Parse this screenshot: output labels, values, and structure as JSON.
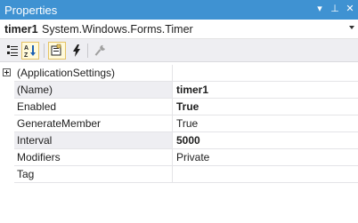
{
  "window": {
    "title": "Properties",
    "buttons": {
      "dropdown": "▾",
      "pin": "⊥",
      "close": "✕"
    }
  },
  "object_selector": {
    "name": "timer1",
    "type": "System.Windows.Forms.Timer"
  },
  "toolbar": {
    "buttons": [
      {
        "icon": "categorized-icon",
        "pressed": false
      },
      {
        "icon": "alphabetical-icon",
        "pressed": true
      },
      {
        "icon": "properties-icon",
        "pressed": true
      },
      {
        "icon": "events-icon",
        "pressed": false
      },
      {
        "icon": "property-pages-icon",
        "pressed": false
      }
    ]
  },
  "properties": [
    {
      "name": "(ApplicationSettings)",
      "value": "",
      "expandable": true
    },
    {
      "name": "(Name)",
      "value": "timer1",
      "bold": true,
      "selected": true
    },
    {
      "name": "Enabled",
      "value": "True",
      "bold": true
    },
    {
      "name": "GenerateMember",
      "value": "True"
    },
    {
      "name": "Interval",
      "value": "5000",
      "bold": true,
      "selected": true
    },
    {
      "name": "Modifiers",
      "value": "Private"
    },
    {
      "name": "Tag",
      "value": ""
    }
  ],
  "colors": {
    "titlebar": "#3f92d2",
    "toolbar": "#eeeef2",
    "pressed_button": "#fffadb",
    "pressed_border": "#e5c365"
  }
}
